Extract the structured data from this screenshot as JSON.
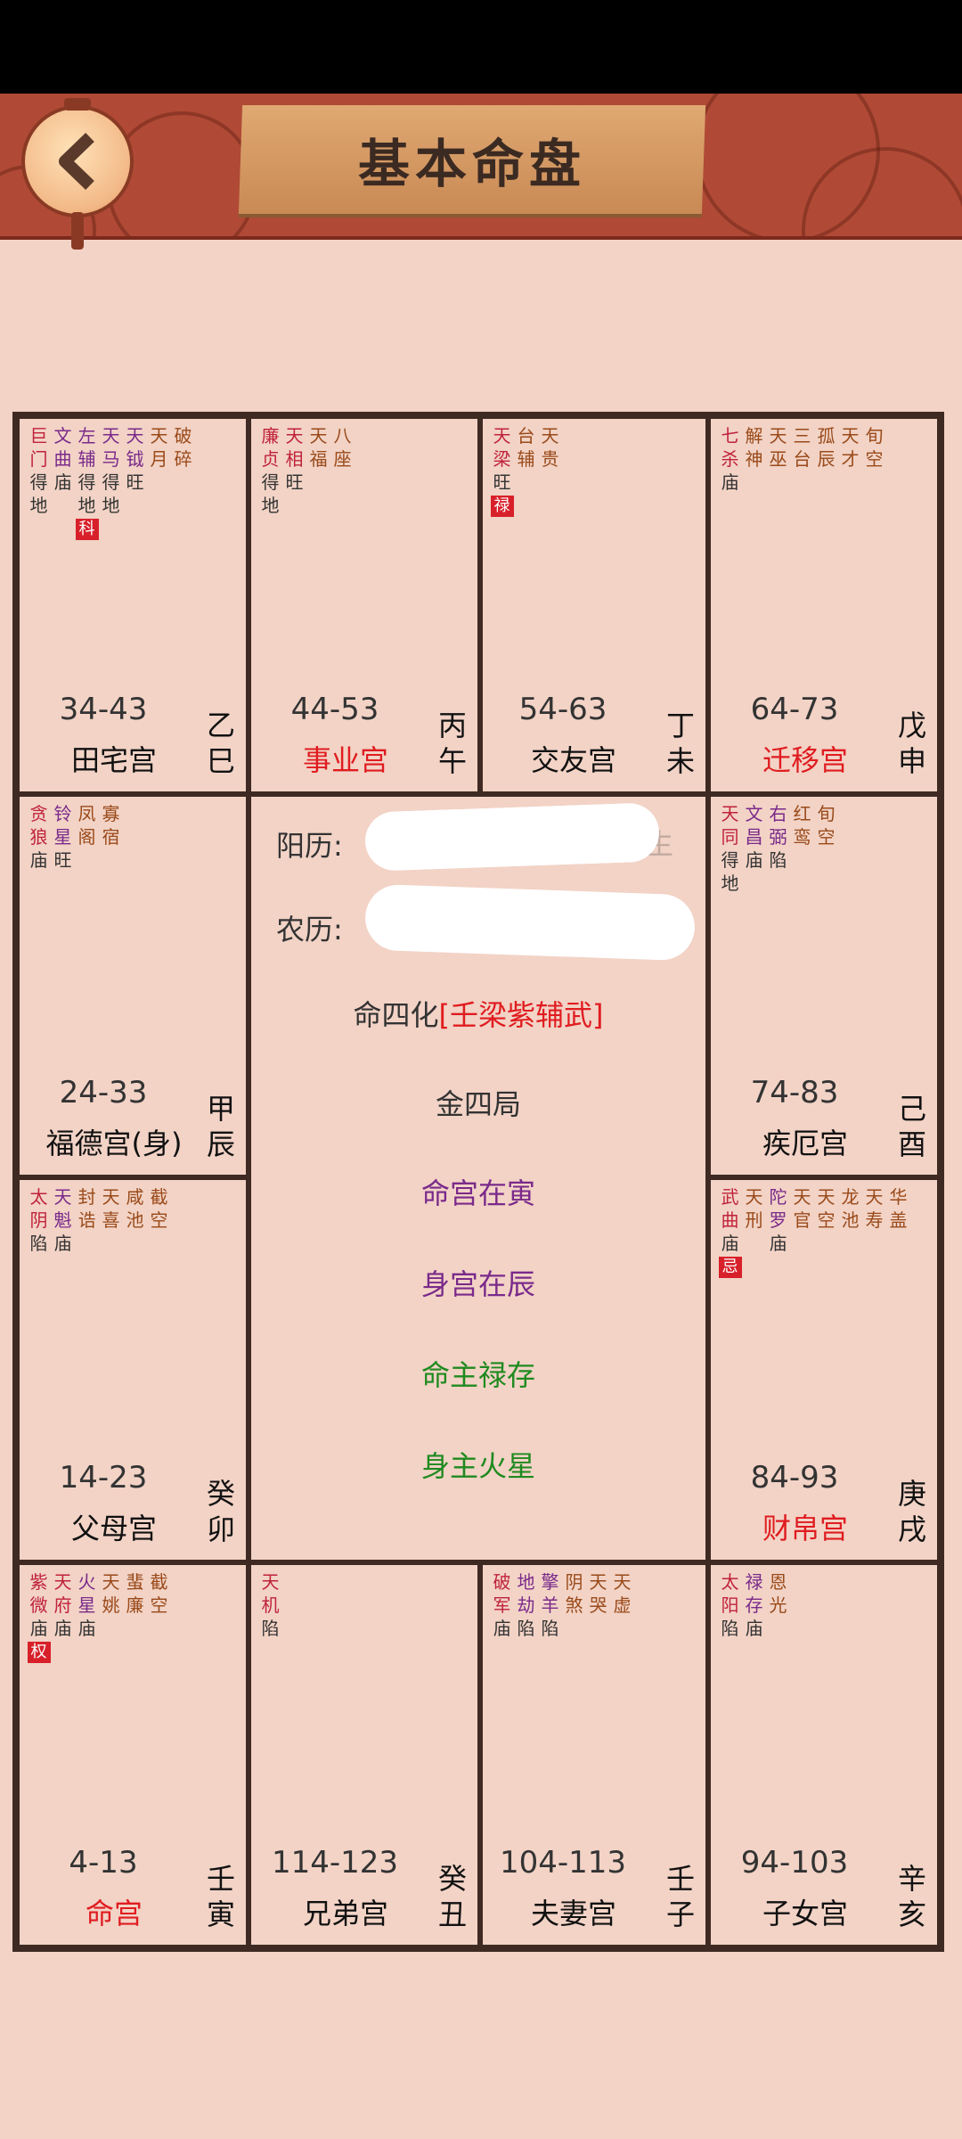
{
  "title": "基本命盘",
  "palaces": [
    {
      "key": "tl1",
      "name": "田宅宫",
      "age": "34-43",
      "stem": [
        "乙",
        "巳"
      ],
      "name_red": false,
      "stars": [
        {
          "n": "巨门",
          "b": "得地",
          "c": "r"
        },
        {
          "n": "文曲",
          "b": "庙",
          "c": "p"
        },
        {
          "n": "左辅",
          "b": "得地",
          "c": "p",
          "hua": "科"
        },
        {
          "n": "天马",
          "b": "得地",
          "c": "p"
        },
        {
          "n": "天钺",
          "b": "旺",
          "c": "p"
        },
        {
          "n": "天月",
          "b": "",
          "c": "b"
        },
        {
          "n": "破碎",
          "b": "",
          "c": "b"
        }
      ]
    },
    {
      "key": "tl2",
      "name": "事业宫",
      "age": "44-53",
      "stem": [
        "丙",
        "午"
      ],
      "name_red": true,
      "stars": [
        {
          "n": "廉贞",
          "b": "得地",
          "c": "r"
        },
        {
          "n": "天相",
          "b": "旺",
          "c": "r"
        },
        {
          "n": "天福",
          "b": "",
          "c": "b"
        },
        {
          "n": "八座",
          "b": "",
          "c": "b"
        }
      ]
    },
    {
      "key": "tl3",
      "name": "交友宫",
      "age": "54-63",
      "stem": [
        "丁",
        "未"
      ],
      "name_red": false,
      "stars": [
        {
          "n": "天梁",
          "b": "旺",
          "c": "r",
          "hua": "禄"
        },
        {
          "n": "台辅",
          "b": "",
          "c": "b"
        },
        {
          "n": "天贵",
          "b": "",
          "c": "b"
        }
      ]
    },
    {
      "key": "tl4",
      "name": "迁移宫",
      "age": "64-73",
      "stem": [
        "戊",
        "申"
      ],
      "name_red": true,
      "stars": [
        {
          "n": "七杀",
          "b": "庙",
          "c": "r"
        },
        {
          "n": "解神",
          "b": "",
          "c": "b"
        },
        {
          "n": "天巫",
          "b": "",
          "c": "b"
        },
        {
          "n": "三台",
          "b": "",
          "c": "b"
        },
        {
          "n": "孤辰",
          "b": "",
          "c": "b"
        },
        {
          "n": "天才",
          "b": "",
          "c": "b"
        },
        {
          "n": "旬空",
          "b": "",
          "c": "b"
        }
      ]
    },
    {
      "key": "ml1",
      "name": "福德宫(身)",
      "age": "24-33",
      "stem": [
        "甲",
        "辰"
      ],
      "name_red": false,
      "stars": [
        {
          "n": "贪狼",
          "b": "庙",
          "c": "r"
        },
        {
          "n": "铃星",
          "b": "旺",
          "c": "p"
        },
        {
          "n": "凤阁",
          "b": "",
          "c": "b"
        },
        {
          "n": "寡宿",
          "b": "",
          "c": "b"
        }
      ]
    },
    {
      "key": "mr1",
      "name": "疾厄宫",
      "age": "74-83",
      "stem": [
        "己",
        "酉"
      ],
      "name_red": false,
      "stars": [
        {
          "n": "天同",
          "b": "得地",
          "c": "r"
        },
        {
          "n": "文昌",
          "b": "庙",
          "c": "p"
        },
        {
          "n": "右弼",
          "b": "陷",
          "c": "p"
        },
        {
          "n": "红鸾",
          "b": "",
          "c": "b"
        },
        {
          "n": "旬空",
          "b": "",
          "c": "b"
        }
      ]
    },
    {
      "key": "ml2",
      "name": "父母宫",
      "age": "14-23",
      "stem": [
        "癸",
        "卯"
      ],
      "name_red": false,
      "stars": [
        {
          "n": "太阴",
          "b": "陷",
          "c": "r"
        },
        {
          "n": "天魁",
          "b": "庙",
          "c": "p"
        },
        {
          "n": "封诰",
          "b": "",
          "c": "b"
        },
        {
          "n": "天喜",
          "b": "",
          "c": "b"
        },
        {
          "n": "咸池",
          "b": "",
          "c": "b"
        },
        {
          "n": "截空",
          "b": "",
          "c": "b"
        }
      ]
    },
    {
      "key": "mr2",
      "name": "财帛宫",
      "age": "84-93",
      "stem": [
        "庚",
        "戌"
      ],
      "name_red": true,
      "stars": [
        {
          "n": "武曲",
          "b": "庙",
          "c": "r",
          "hua": "忌"
        },
        {
          "n": "天刑",
          "b": "",
          "c": "b"
        },
        {
          "n": "陀罗",
          "b": "庙",
          "c": "p"
        },
        {
          "n": "天官",
          "b": "",
          "c": "b"
        },
        {
          "n": "天空",
          "b": "",
          "c": "b"
        },
        {
          "n": "龙池",
          "b": "",
          "c": "b"
        },
        {
          "n": "天寿",
          "b": "",
          "c": "b"
        },
        {
          "n": "华盖",
          "b": "",
          "c": "b"
        }
      ]
    },
    {
      "key": "bl1",
      "name": "命宫",
      "age": "4-13",
      "stem": [
        "壬",
        "寅"
      ],
      "name_red": true,
      "stars": [
        {
          "n": "紫微",
          "b": "庙",
          "c": "r",
          "hua": "权"
        },
        {
          "n": "天府",
          "b": "庙",
          "c": "r"
        },
        {
          "n": "火星",
          "b": "庙",
          "c": "p"
        },
        {
          "n": "天姚",
          "b": "",
          "c": "b"
        },
        {
          "n": "蜚廉",
          "b": "",
          "c": "b"
        },
        {
          "n": "截空",
          "b": "",
          "c": "b"
        }
      ]
    },
    {
      "key": "bl2",
      "name": "兄弟宫",
      "age": "114-123",
      "stem": [
        "癸",
        "丑"
      ],
      "name_red": false,
      "stars": [
        {
          "n": "天机",
          "b": "陷",
          "c": "r"
        }
      ]
    },
    {
      "key": "bl3",
      "name": "夫妻宫",
      "age": "104-113",
      "stem": [
        "壬",
        "子"
      ],
      "name_red": false,
      "stars": [
        {
          "n": "破军",
          "b": "庙",
          "c": "r"
        },
        {
          "n": "地劫",
          "b": "陷",
          "c": "p"
        },
        {
          "n": "擎羊",
          "b": "陷",
          "c": "p"
        },
        {
          "n": "阴煞",
          "b": "",
          "c": "b"
        },
        {
          "n": "天哭",
          "b": "",
          "c": "b"
        },
        {
          "n": "天虚",
          "b": "",
          "c": "b"
        }
      ]
    },
    {
      "key": "bl4",
      "name": "子女宫",
      "age": "94-103",
      "stem": [
        "辛",
        "亥"
      ],
      "name_red": false,
      "stars": [
        {
          "n": "太阳",
          "b": "陷",
          "c": "r"
        },
        {
          "n": "禄存",
          "b": "庙",
          "c": "p"
        },
        {
          "n": "恩光",
          "b": "",
          "c": "b"
        }
      ]
    }
  ],
  "center": {
    "solar_label": "阳历:",
    "solar_suffix": "时生",
    "lunar_label": "农历:",
    "sihua_label": "命四化",
    "sihua_value": "[壬梁紫辅武]",
    "ju": "金四局",
    "ming_gong": "命宫在寅",
    "shen_gong": "身宫在辰",
    "ming_zhu": "命主禄存",
    "shen_zhu": "身主火星"
  },
  "colors": {
    "red": "#e01c20",
    "purple": "#7a2a8a",
    "green": "#1f8a1f",
    "frame": "#3e2a22",
    "bg": "#f2d3c6"
  }
}
